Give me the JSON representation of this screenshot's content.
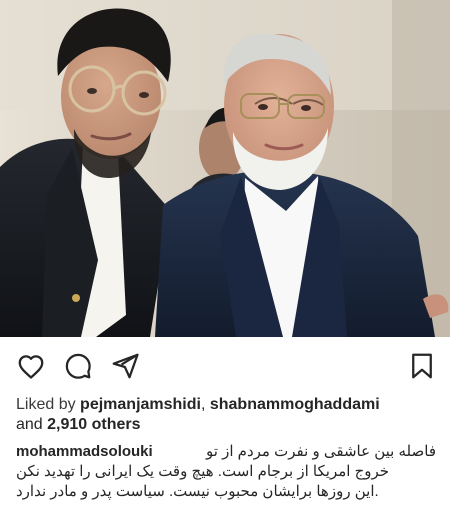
{
  "post": {
    "image_alt": "two men posing for a photo",
    "actions": {
      "like_icon": "heart-icon",
      "comment_icon": "comment-icon",
      "share_icon": "share-icon",
      "save_icon": "bookmark-icon"
    },
    "likes": {
      "prefix": "Liked by ",
      "user1": "pejmanjamshidi",
      "separator": ", ",
      "user2": "shabnammoghaddami",
      "and_text": "and ",
      "others": "2,910 others"
    },
    "caption": {
      "username": "mohammadsolouki",
      "line1": "فاصله بین عاشقی و نفرت مردم از تو",
      "line2": "خروج امریکا از برجام است. هیچ وقت یک ایرانی را تهدید نکن",
      "line3": ".این روزها برایشان محبوب نیست. سیاست پدر و مادر ندارد"
    }
  },
  "colors": {
    "text": "#262626",
    "background": "#ffffff"
  }
}
